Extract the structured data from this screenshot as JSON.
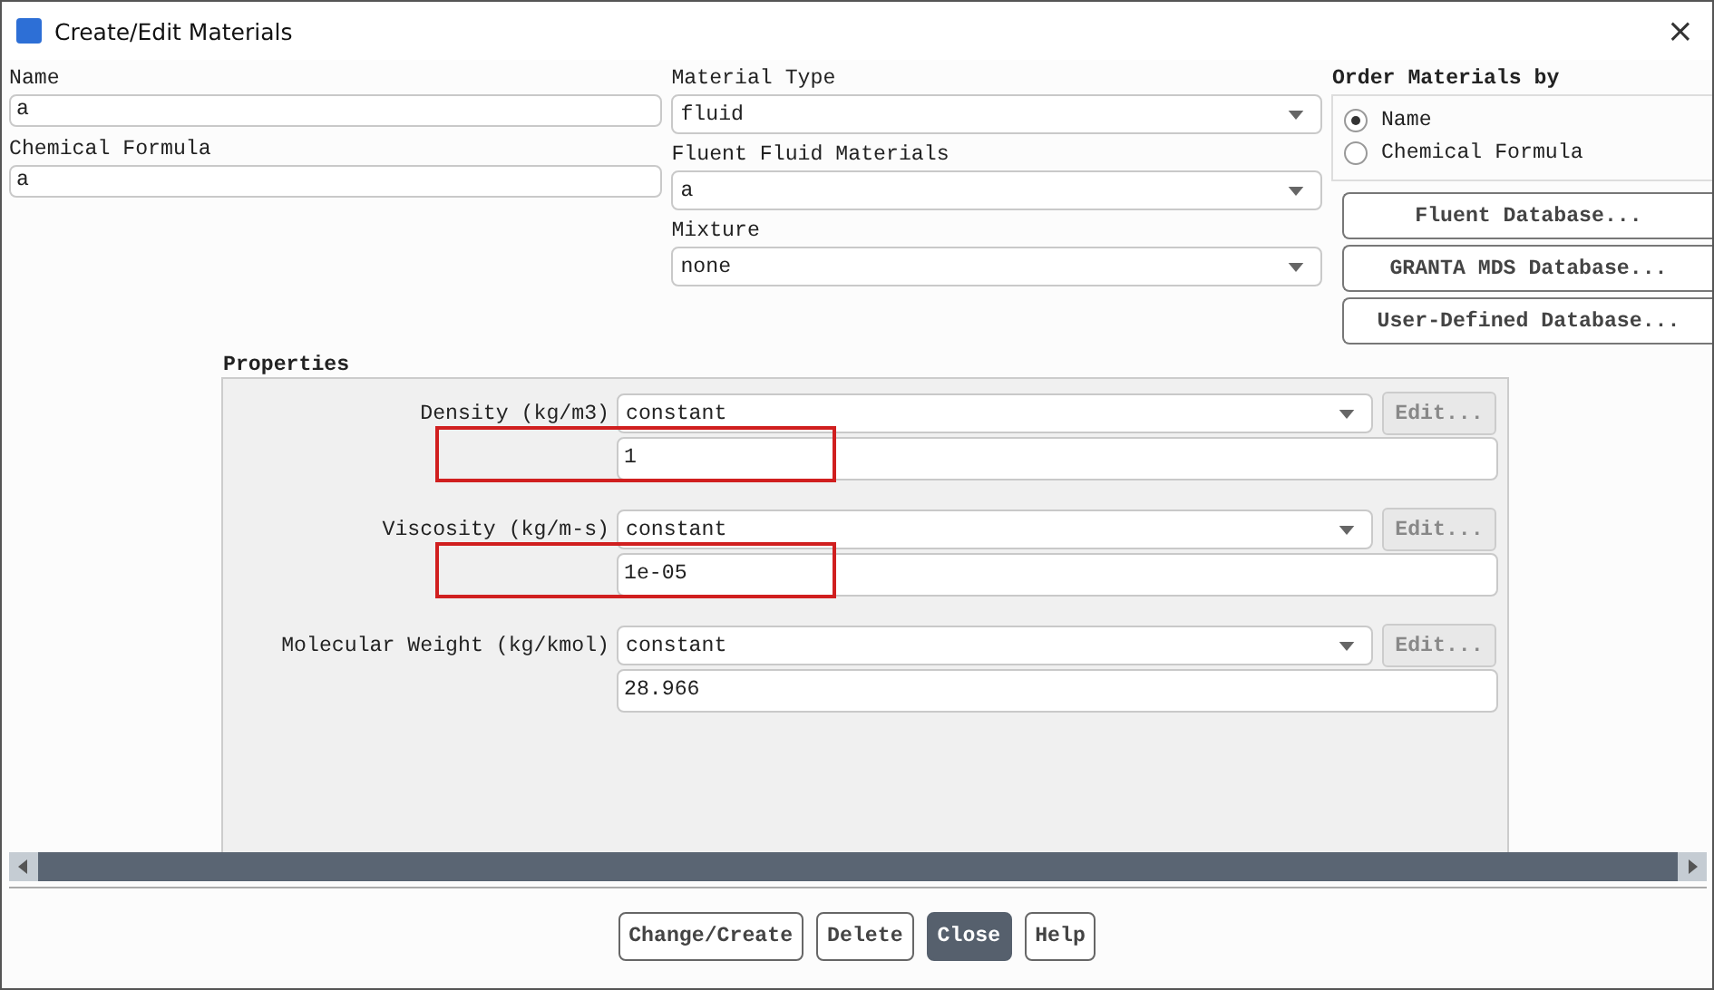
{
  "window": {
    "title": "Create/Edit Materials",
    "close": "×"
  },
  "fields": [
    {
      "label": "Name",
      "value": "a"
    },
    {
      "label": "Chemical Formula",
      "value": "a"
    }
  ],
  "dropdowns": [
    {
      "label": "Material Type",
      "value": "fluid"
    },
    {
      "label": "Fluent Fluid Materials",
      "value": "a"
    },
    {
      "label": "Mixture",
      "value": "none"
    }
  ],
  "order_by": {
    "label": "Order Materials by",
    "options": [
      {
        "label": "Name",
        "selected": true
      },
      {
        "label": "Chemical Formula",
        "selected": false
      }
    ]
  },
  "database_buttons": [
    "Fluent Database...",
    "GRANTA MDS Database...",
    "User-Defined Database..."
  ],
  "properties": {
    "title": "Properties",
    "rows": [
      {
        "label": "Density (kg/m3)",
        "method": "constant",
        "edit": "Edit...",
        "value": "1",
        "highlighted": true
      },
      {
        "label": "Viscosity (kg/m-s)",
        "method": "constant",
        "edit": "Edit...",
        "value": "1e-05",
        "highlighted": true
      },
      {
        "label": "Molecular Weight (kg/kmol)",
        "method": "constant",
        "edit": "Edit...",
        "value": "28.966",
        "highlighted": false
      }
    ]
  },
  "buttons": [
    {
      "label": "Change/Create",
      "selected": false
    },
    {
      "label": "Delete",
      "selected": false
    },
    {
      "label": "Close",
      "selected": true
    },
    {
      "label": "Help",
      "selected": false
    }
  ]
}
